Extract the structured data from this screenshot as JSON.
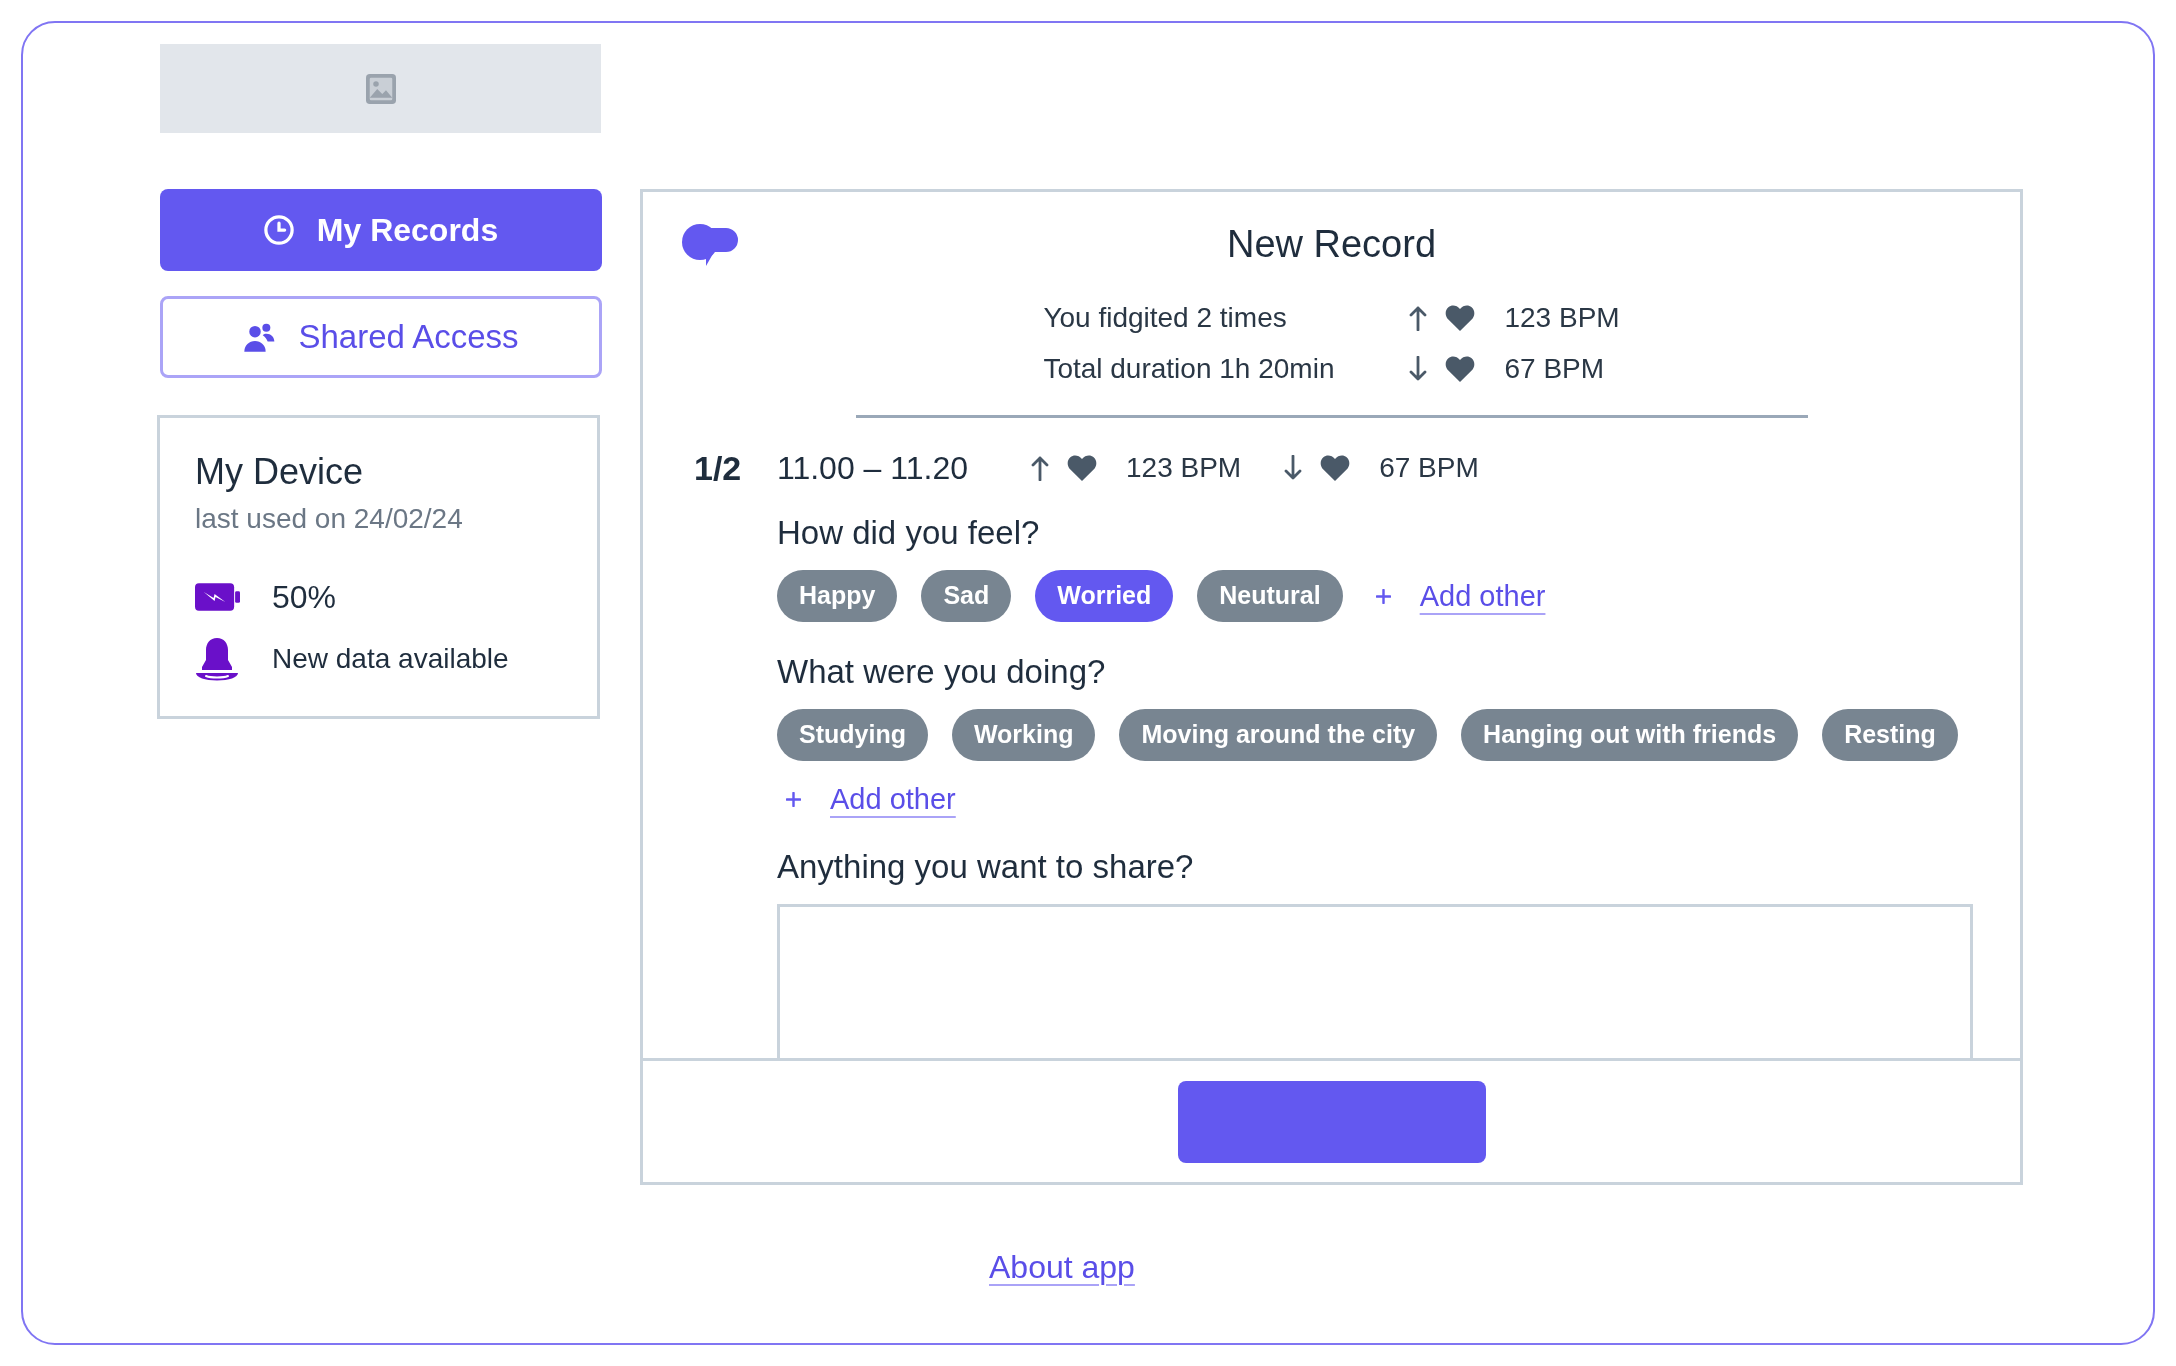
{
  "sidebar": {
    "nav": [
      {
        "label": "My Records",
        "selected": true
      },
      {
        "label": "Shared Access",
        "selected": false
      }
    ],
    "device": {
      "title": "My Device",
      "last_used": "last used on 24/02/24",
      "battery": "50%",
      "notification": "New data available"
    }
  },
  "record": {
    "title": "New Record",
    "summary": [
      {
        "label": "You fidgited 2 times",
        "kind": "max",
        "reading": "123 BPM"
      },
      {
        "label": "Total duration 1h 20min",
        "kind": "min",
        "reading": "67 BPM"
      }
    ],
    "segment": {
      "index": "1/2",
      "time": "11.00 – 11.20",
      "heart_rates": [
        {
          "kind": "max",
          "reading": "123 BPM"
        },
        {
          "kind": "min",
          "reading": "67 BPM"
        }
      ]
    },
    "questions": [
      {
        "kind": "chips",
        "label": "How did you feel?",
        "options": [
          {
            "label": "Happy",
            "selected": false
          },
          {
            "label": "Sad",
            "selected": false
          },
          {
            "label": "Worried",
            "selected": true
          },
          {
            "label": "Neutural",
            "selected": false
          }
        ],
        "add_label": "Add other"
      },
      {
        "kind": "chips",
        "label": "What were you doing?",
        "options": [
          {
            "label": "Studying",
            "selected": false
          },
          {
            "label": "Working",
            "selected": false
          },
          {
            "label": "Moving around the city",
            "selected": false
          },
          {
            "label": "Hanging out with friends",
            "selected": false
          },
          {
            "label": "Resting",
            "selected": false
          }
        ],
        "add_label": "Add other"
      },
      {
        "kind": "text",
        "label": "Anything you want to share?"
      }
    ]
  },
  "footer_link": "About app"
}
